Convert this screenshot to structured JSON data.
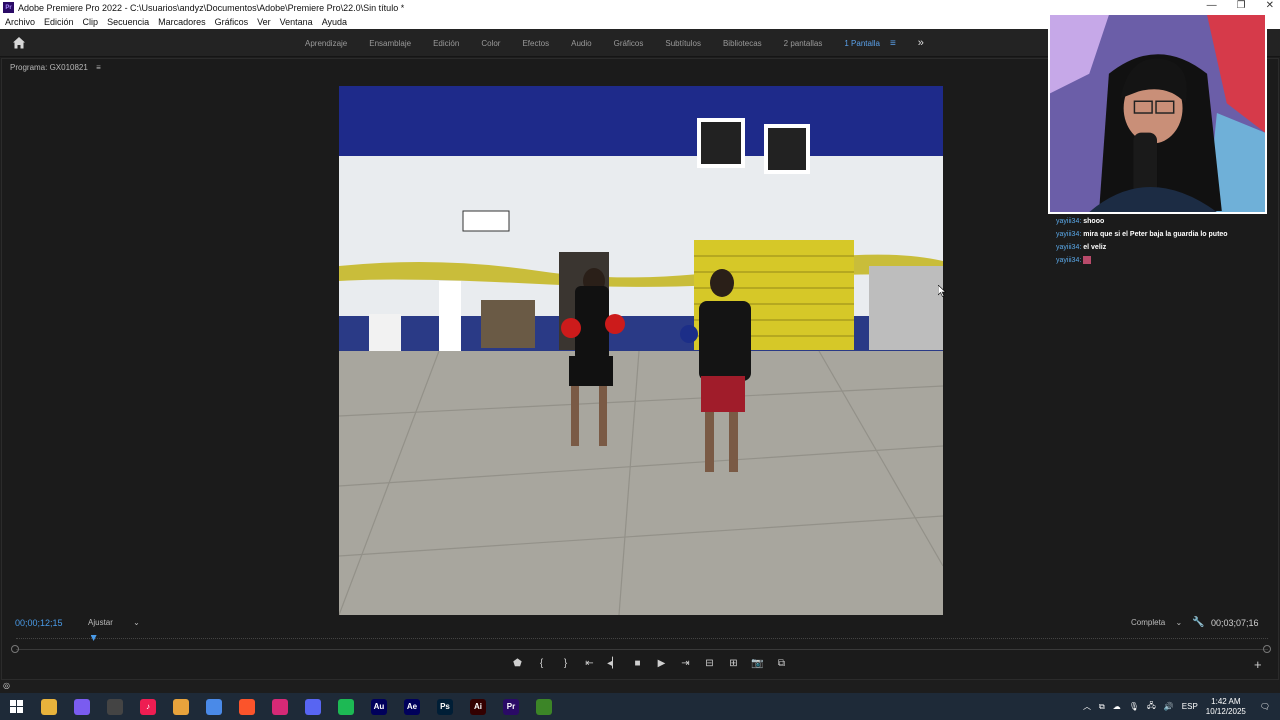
{
  "window": {
    "title": "Adobe Premiere Pro 2022 - C:\\Usuarios\\andyz\\Documentos\\Adobe\\Premiere Pro\\22.0\\Sin título *",
    "app_icon_text": "Pr"
  },
  "menu": [
    "Archivo",
    "Edición",
    "Clip",
    "Secuencia",
    "Marcadores",
    "Gráficos",
    "Ver",
    "Ventana",
    "Ayuda"
  ],
  "workspaces": [
    "Aprendizaje",
    "Ensamblaje",
    "Edición",
    "Color",
    "Efectos",
    "Audio",
    "Gráficos",
    "Subtítulos",
    "Bibliotecas",
    "2 pantallas"
  ],
  "active_workspace": "1 Pantalla",
  "program_panel": {
    "title": "Programa: GX010821",
    "current_time": "00;00;12;15",
    "fit": "Ajustar",
    "resolution": "Completa",
    "duration": "00;03;07;16",
    "playhead_fraction": 0.062
  },
  "chat": [
    {
      "user": "yayiii34:",
      "message": "shooo"
    },
    {
      "user": "yayiii34:",
      "message": "mira que si el Peter baja la guardia lo puteo"
    },
    {
      "user": "yayiii34:",
      "message": "el veliz"
    },
    {
      "user": "yayiii34:",
      "message": ""
    }
  ],
  "taskbar": {
    "apps": [
      {
        "name": "Explorador",
        "label": "",
        "color": "#e8b33c"
      },
      {
        "name": "OBS",
        "label": "",
        "color": "#7a5cf0"
      },
      {
        "name": "Tool",
        "label": "",
        "color": "#444444"
      },
      {
        "name": "TikTok",
        "label": "♪",
        "color": "#ee1d52"
      },
      {
        "name": "Chrome",
        "label": "",
        "color": "#e8a33c"
      },
      {
        "name": "Copilot",
        "label": "",
        "color": "#4a8ae8"
      },
      {
        "name": "Brave",
        "label": "",
        "color": "#fb542b"
      },
      {
        "name": "Instagram",
        "label": "",
        "color": "#d62976"
      },
      {
        "name": "Discord",
        "label": "",
        "color": "#5865f2"
      },
      {
        "name": "Spotify",
        "label": "",
        "color": "#1db954"
      },
      {
        "name": "Audition",
        "label": "Au",
        "color": "#00005b"
      },
      {
        "name": "After Effects",
        "label": "Ae",
        "color": "#00005b"
      },
      {
        "name": "Photoshop",
        "label": "Ps",
        "color": "#001e36"
      },
      {
        "name": "Illustrator",
        "label": "Ai",
        "color": "#330000"
      },
      {
        "name": "Premiere",
        "label": "Pr",
        "color": "#2a0a66"
      },
      {
        "name": "Minecraft",
        "label": "",
        "color": "#3c8527"
      }
    ],
    "lang": "ESP",
    "time": "1:42 AM",
    "date": "10/12/2025"
  }
}
